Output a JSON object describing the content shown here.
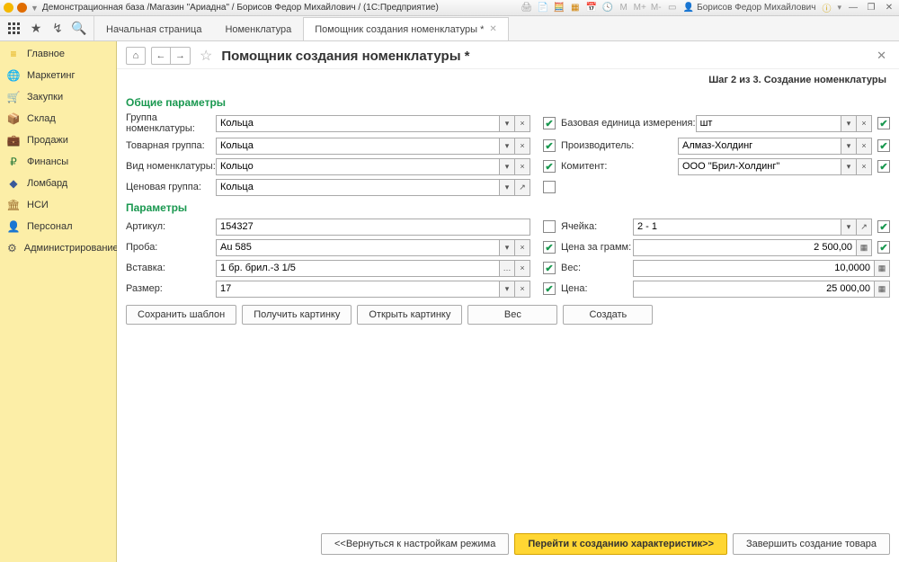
{
  "titlebar": {
    "text": "Демонстрационная база /Магазин \"Ариадна\" / Борисов Федор Михайлович / (1С:Предприятие)",
    "user": "Борисов Федор Михайлович",
    "letters": [
      "M",
      "M+",
      "M-"
    ]
  },
  "tabs": {
    "t0": "Начальная страница",
    "t1": "Номенклатура",
    "t2": "Помощник создания номенклатуры *"
  },
  "sidebar": [
    {
      "icon": "≡",
      "label": "Главное",
      "color": "#e0a800"
    },
    {
      "icon": "🌐",
      "label": "Маркетинг",
      "color": "#c97c1e"
    },
    {
      "icon": "🛒",
      "label": "Закупки",
      "color": "#3a7e3a"
    },
    {
      "icon": "📦",
      "label": "Склад",
      "color": "#7a5c3a"
    },
    {
      "icon": "💼",
      "label": "Продажи",
      "color": "#a07030"
    },
    {
      "icon": "₽",
      "label": "Финансы",
      "color": "#2a7a3a"
    },
    {
      "icon": "💎",
      "label": "Ломбард",
      "color": "#3a5a9a"
    },
    {
      "icon": "🏛",
      "label": "НСИ",
      "color": "#9a6a2a"
    },
    {
      "icon": "👤",
      "label": "Персонал",
      "color": "#c05030"
    },
    {
      "icon": "⚙",
      "label": "Администрирование",
      "color": "#555"
    }
  ],
  "page": {
    "title": "Помощник создания номенклатуры *",
    "step": "Шаг 2 из 3. Создание номенклатуры"
  },
  "sections": {
    "s1": "Общие параметры",
    "s2": "Параметры"
  },
  "labels": {
    "group_nom": "Группа номенклатуры:",
    "tov_group": "Товарная группа:",
    "vid_nom": "Вид номенклатуры:",
    "price_group": "Ценовая группа:",
    "base_unit": "Базовая единица измерения:",
    "manufacturer": "Производитель:",
    "komitent": "Комитент:",
    "articul": "Артикул:",
    "proba": "Проба:",
    "vstavka": "Вставка:",
    "razmer": "Размер:",
    "yacheika": "Ячейка:",
    "price_gram": "Цена за грамм:",
    "ves": "Вес:",
    "tsena": "Цена:"
  },
  "values": {
    "group_nom": "Кольца",
    "tov_group": "Кольца",
    "vid_nom": "Кольцо",
    "price_group": "Кольца",
    "base_unit": "шт",
    "manufacturer": "Алмаз-Холдинг",
    "komitent": "ООО \"Брил-Холдинг\"",
    "articul": "154327",
    "proba": "Au 585",
    "vstavka": "1 бр. брил.-3 1/5",
    "razmer": "17",
    "yacheika": "2 - 1",
    "price_gram": "2 500,00",
    "ves": "10,0000",
    "tsena": "25 000,00"
  },
  "buttons": {
    "save_tmpl": "Сохранить шаблон",
    "get_img": "Получить картинку",
    "open_img": "Открыть картинку",
    "weight": "Вес",
    "create": "Создать",
    "back": "<<Вернуться к настройкам режима",
    "next": "Перейти к созданию характеристик>>",
    "finish": "Завершить создание товара"
  }
}
